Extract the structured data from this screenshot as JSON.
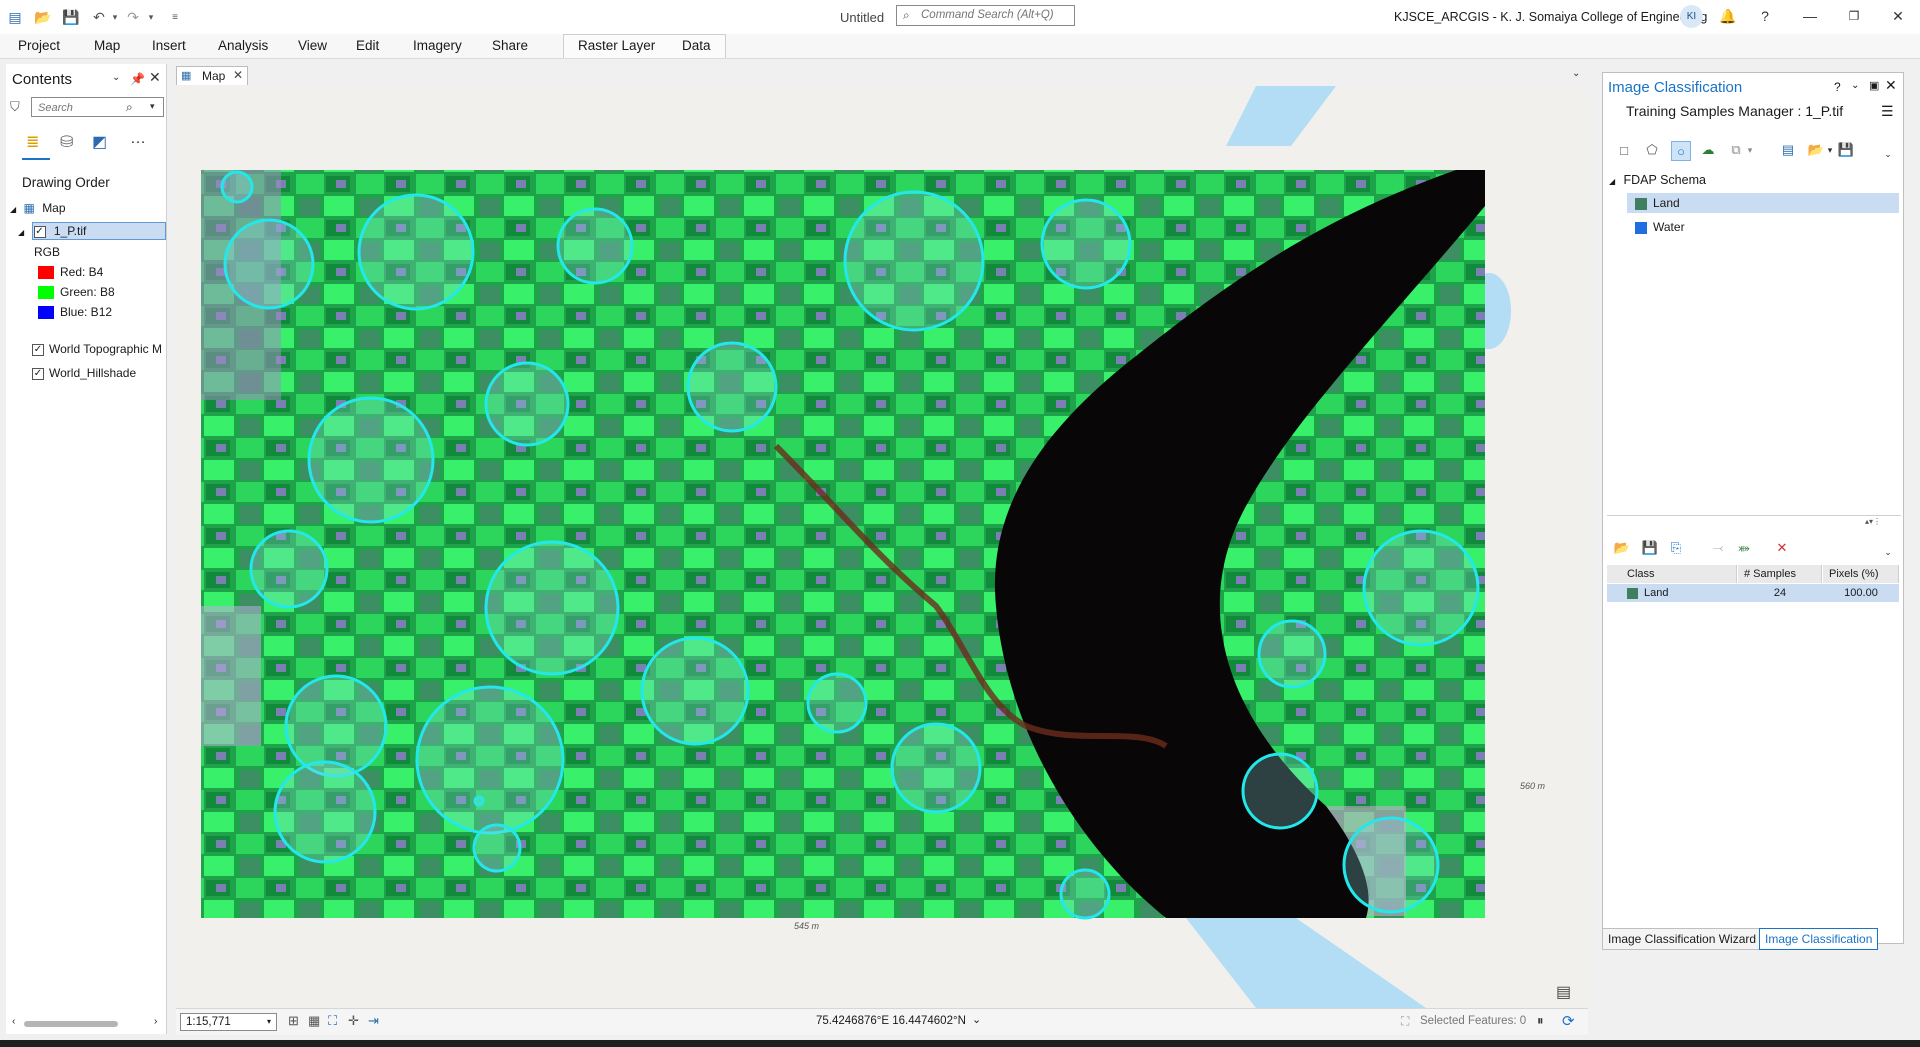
{
  "titlebar": {
    "doc_title": "Untitled",
    "search_placeholder": "Command Search (Alt+Q)",
    "org_name": "KJSCE_ARCGIS - K. J. Somaiya College of Engineering",
    "avatar_initials": "KI",
    "help": "?"
  },
  "ribbon": {
    "tabs": [
      "Project",
      "Map",
      "Insert",
      "Analysis",
      "View",
      "Edit",
      "Imagery",
      "Share",
      "Raster Layer",
      "Data"
    ]
  },
  "contents": {
    "title": "Contents",
    "search_placeholder": "Search",
    "drawing_order": "Drawing Order",
    "map_label": "Map",
    "layer_label": "1_P.tif",
    "renderer": "RGB",
    "bands": [
      {
        "label": "Red:  B4",
        "color": "#ff0000"
      },
      {
        "label": "Green:  B8",
        "color": "#00ff00"
      },
      {
        "label": "Blue:  B12",
        "color": "#0000ff"
      }
    ],
    "basemap1": "World Topographic M",
    "basemap2": "World_Hillshade"
  },
  "map": {
    "tab_label": "Map",
    "scale": "1:15,771",
    "coords": "75.4246876°E 16.4474602°N",
    "selected_features": "Selected Features: 0",
    "label_560": "560 m",
    "label_545": "545 m"
  },
  "ic_pane": {
    "title": "Image Classification",
    "subtitle": "Training Samples Manager : 1_P.tif",
    "schema_name": "FDAP Schema",
    "classes": [
      {
        "name": "Land",
        "color": "#3f7f5f"
      },
      {
        "name": "Water",
        "color": "#1f6fe0"
      }
    ],
    "table_headers": [
      "Class",
      "# Samples",
      "Pixels (%)"
    ],
    "table_rows": [
      {
        "class": "Land",
        "samples": "24",
        "pixels": "100.00",
        "color": "#3f7f5f"
      }
    ],
    "bottom_tabs": [
      "Image Classification Wizard",
      "Image Classification"
    ]
  },
  "colors": {
    "accent": "#1a73c8",
    "sample_circle": "#22e8ec"
  }
}
